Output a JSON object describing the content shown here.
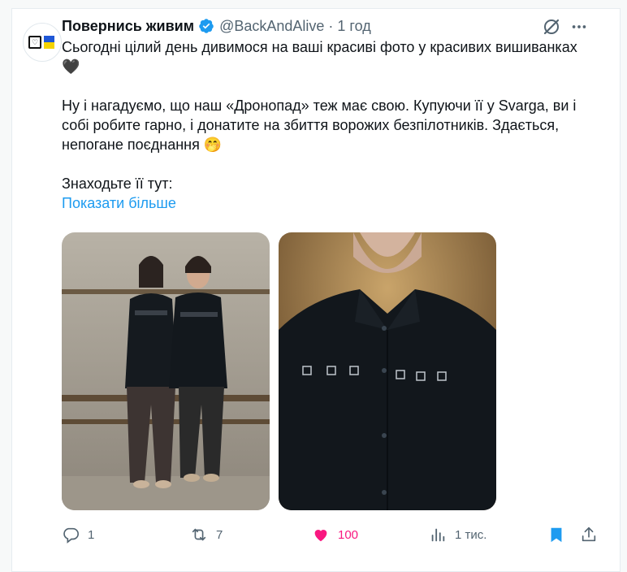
{
  "account": {
    "name": "Повернись живим",
    "handle": "@BackAndAlive",
    "separator": "·",
    "time": "1 год"
  },
  "tweet": {
    "line1": "Сьогодні цілий день дивимося на ваші красиві фото у красивих вишиванках 🖤",
    "line2": "Ну і нагадуємо, що наш «Дронопад» теж має свою. Купуючи її у Svarga, ви і собі робите гарно, і донатите на збиття ворожих безпілотників. Здається, непогане поєднання 🤭",
    "line3": "Знаходьте її тут:",
    "show_more": "Показати більше"
  },
  "actions": {
    "replies": "1",
    "reposts": "7",
    "likes": "100",
    "views": "1 тис."
  },
  "colors": {
    "accent": "#1d9bf0",
    "like": "#f91880",
    "muted": "#536471"
  },
  "icons": [
    "verified-icon",
    "grok-icon",
    "more-icon",
    "reply-icon",
    "repost-icon",
    "like-icon",
    "views-icon",
    "bookmark-icon",
    "share-icon"
  ]
}
